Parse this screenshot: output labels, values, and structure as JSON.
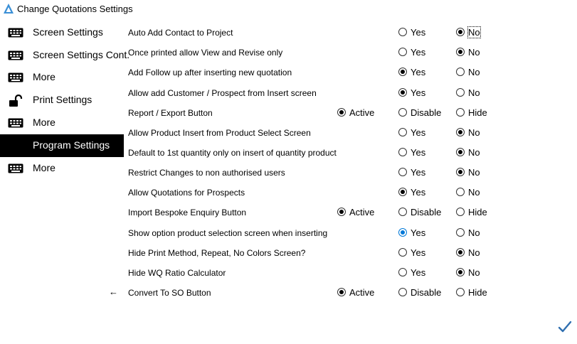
{
  "window": {
    "title": "Change Quotations Settings"
  },
  "sidebar": {
    "items": [
      {
        "label": "Screen Settings",
        "icon": "keyboard-icon",
        "active": false
      },
      {
        "label": "Screen Settings Cont.",
        "icon": "keyboard-icon",
        "active": false
      },
      {
        "label": "More",
        "icon": "keyboard-icon",
        "active": false
      },
      {
        "label": "Print Settings",
        "icon": "unlock-icon",
        "active": false
      },
      {
        "label": "More",
        "icon": "keyboard-icon",
        "active": false
      },
      {
        "label": "Program Settings",
        "icon": "",
        "active": true
      },
      {
        "label": "More",
        "icon": "keyboard-icon",
        "active": false
      }
    ]
  },
  "settings": [
    {
      "label": "Auto Add Contact to Project",
      "options": [
        {
          "label": "Yes",
          "selected": false
        },
        {
          "label": "No",
          "selected": true,
          "focused": true
        }
      ]
    },
    {
      "label": "Once printed allow View and Revise only",
      "options": [
        {
          "label": "Yes",
          "selected": false
        },
        {
          "label": "No",
          "selected": true
        }
      ]
    },
    {
      "label": "Add Follow up after inserting new quotation",
      "options": [
        {
          "label": "Yes",
          "selected": true
        },
        {
          "label": "No",
          "selected": false
        }
      ]
    },
    {
      "label": "Allow add Customer / Prospect from Insert screen",
      "options": [
        {
          "label": "Yes",
          "selected": true
        },
        {
          "label": "No",
          "selected": false
        }
      ]
    },
    {
      "label": "Report / Export Button",
      "options": [
        {
          "label": "Active",
          "selected": true
        },
        {
          "label": "Disable",
          "selected": false
        },
        {
          "label": "Hide",
          "selected": false
        }
      ]
    },
    {
      "label": "Allow Product Insert from Product Select Screen",
      "options": [
        {
          "label": "Yes",
          "selected": false
        },
        {
          "label": "No",
          "selected": true
        }
      ]
    },
    {
      "label": "Default to 1st quantity only on insert of quantity product",
      "options": [
        {
          "label": "Yes",
          "selected": false
        },
        {
          "label": "No",
          "selected": true
        }
      ]
    },
    {
      "label": "Restrict Changes to non authorised users",
      "options": [
        {
          "label": "Yes",
          "selected": false
        },
        {
          "label": "No",
          "selected": true
        }
      ]
    },
    {
      "label": "Allow Quotations for Prospects",
      "options": [
        {
          "label": "Yes",
          "selected": true
        },
        {
          "label": "No",
          "selected": false
        }
      ]
    },
    {
      "label": "Import Bespoke Enquiry Button",
      "options": [
        {
          "label": "Active",
          "selected": true
        },
        {
          "label": "Disable",
          "selected": false
        },
        {
          "label": "Hide",
          "selected": false
        }
      ]
    },
    {
      "label": "Show option product selection screen when inserting",
      "options": [
        {
          "label": "Yes",
          "selected": true,
          "accent": true
        },
        {
          "label": "No",
          "selected": false
        }
      ]
    },
    {
      "label": "Hide Print Method, Repeat, No Colors Screen?",
      "options": [
        {
          "label": "Yes",
          "selected": false
        },
        {
          "label": "No",
          "selected": true
        }
      ]
    },
    {
      "label": "Hide WQ Ratio Calculator",
      "options": [
        {
          "label": "Yes",
          "selected": false
        },
        {
          "label": "No",
          "selected": true
        }
      ]
    },
    {
      "label": "Convert To SO Button",
      "arrow": "←",
      "options": [
        {
          "label": "Active",
          "selected": true
        },
        {
          "label": "Disable",
          "selected": false
        },
        {
          "label": "Hide",
          "selected": false
        }
      ]
    }
  ],
  "colors": {
    "accent": "#0078d7",
    "confirm": "#2f6fb0",
    "sidebar_active_bg": "#000000"
  },
  "confirm_icon": "checkmark-icon"
}
